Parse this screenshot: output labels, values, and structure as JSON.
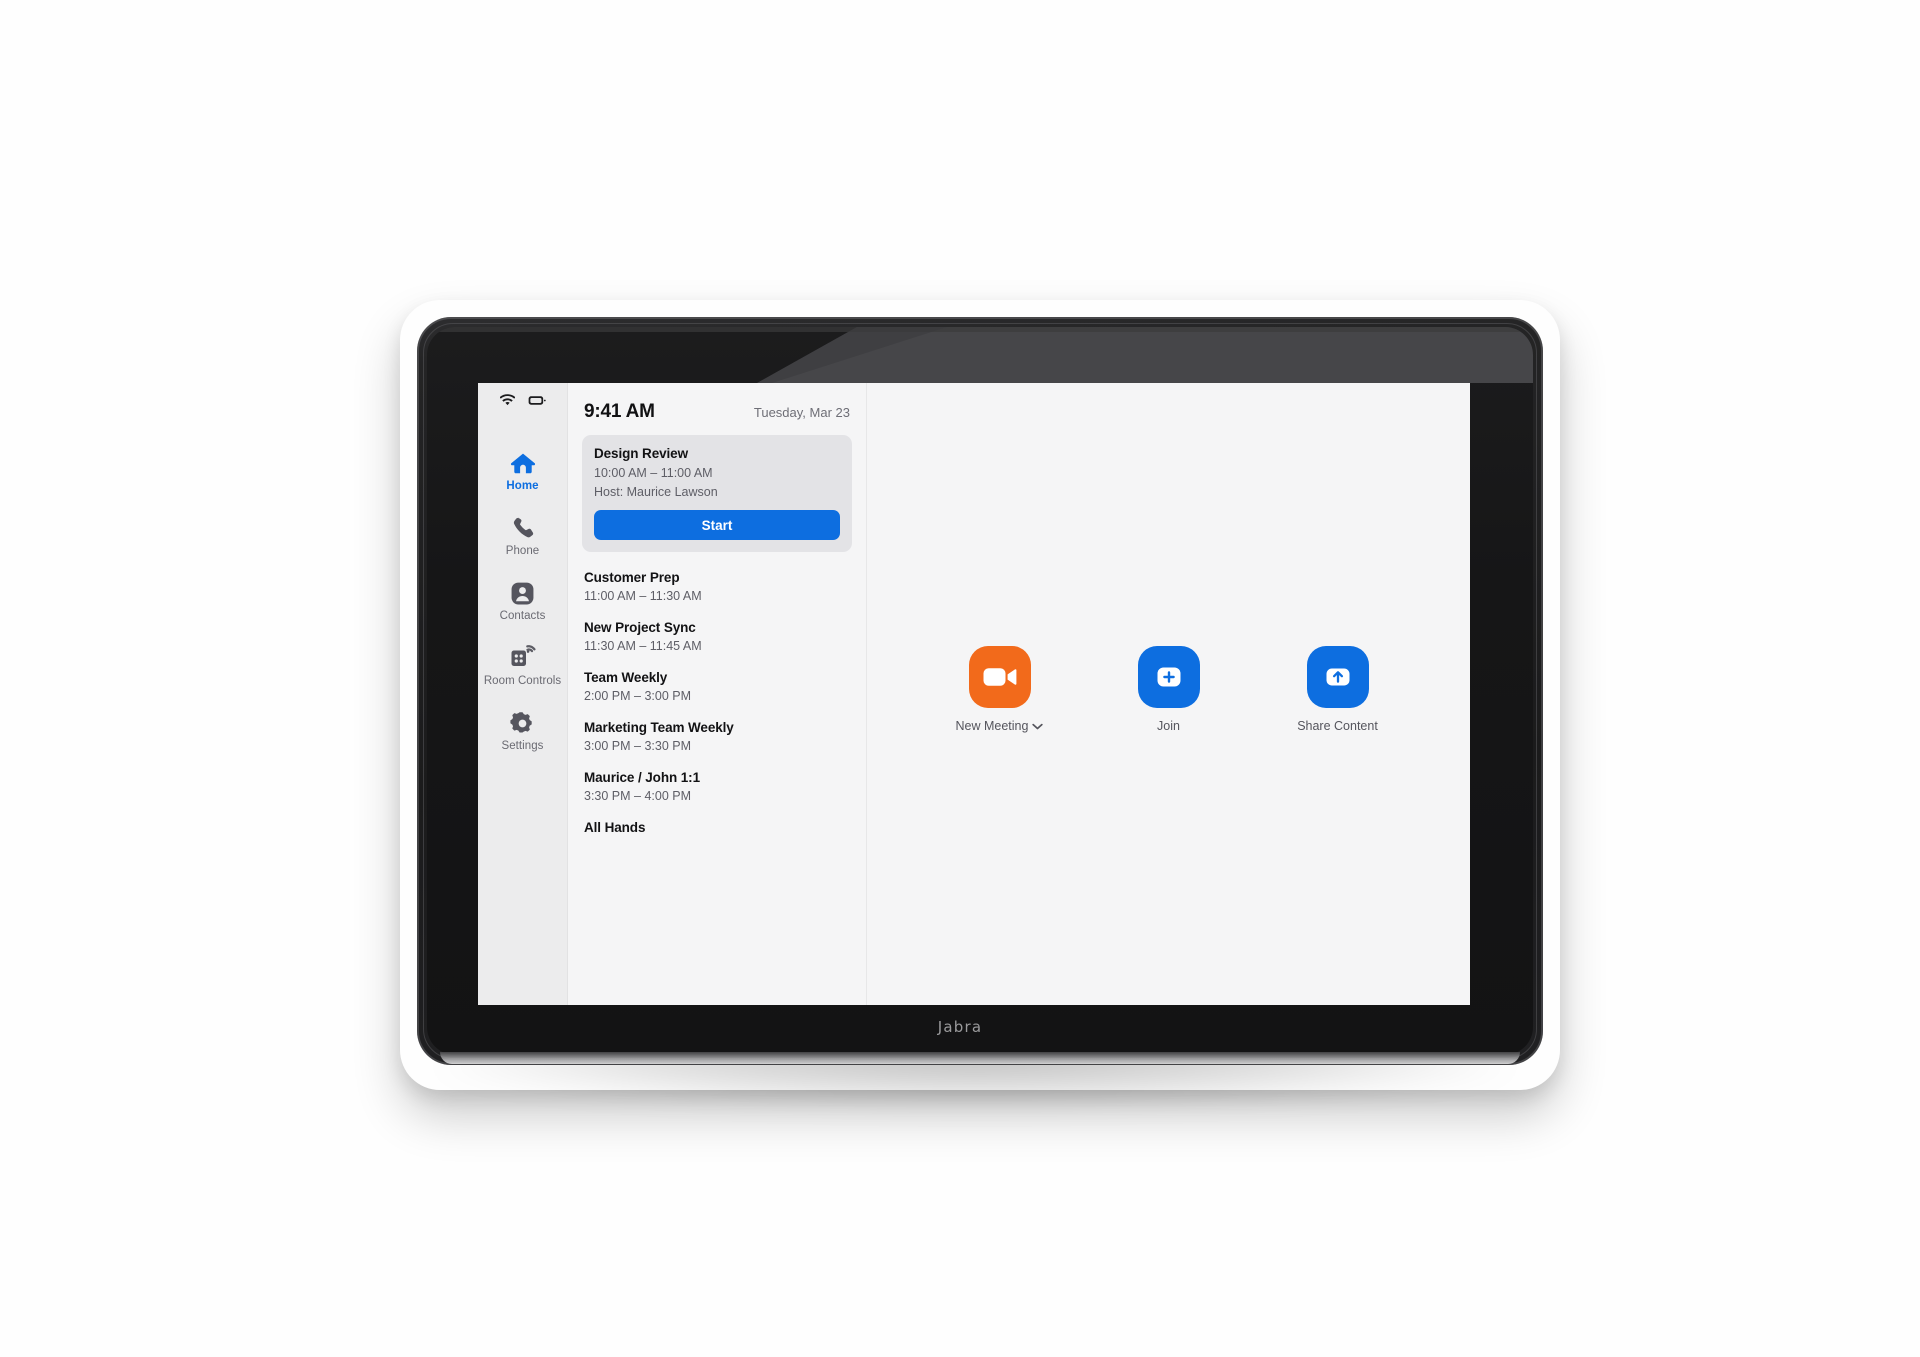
{
  "device": {
    "brand": "Jabra",
    "type": "touch-controller"
  },
  "statusbar": {
    "wifi_icon": "wifi-icon",
    "battery_icon": "battery-icon"
  },
  "sidebar": {
    "items": [
      {
        "label": "Home",
        "icon": "home-icon",
        "active": true
      },
      {
        "label": "Phone",
        "icon": "phone-icon",
        "active": false
      },
      {
        "label": "Contacts",
        "icon": "contacts-icon",
        "active": false
      },
      {
        "label": "Room Controls",
        "icon": "room-controls-icon",
        "active": false
      },
      {
        "label": "Settings",
        "icon": "gear-icon",
        "active": false
      }
    ]
  },
  "header": {
    "time": "9:41 AM",
    "date": "Tuesday, Mar 23"
  },
  "current_meeting": {
    "title": "Design Review",
    "time": "10:00 AM – 11:00 AM",
    "host": "Host: Maurice Lawson",
    "start_label": "Start"
  },
  "upcoming_meetings": [
    {
      "title": "Customer Prep",
      "time": "11:00 AM – 11:30 AM"
    },
    {
      "title": "New Project Sync",
      "time": "11:30 AM – 11:45 AM"
    },
    {
      "title": "Team Weekly",
      "time": "2:00 PM – 3:00 PM"
    },
    {
      "title": "Marketing Team Weekly",
      "time": "3:00 PM – 3:30 PM"
    },
    {
      "title": "Maurice / John 1:1",
      "time": "3:30 PM – 4:00 PM"
    },
    {
      "title": "All Hands",
      "time": ""
    }
  ],
  "actions": [
    {
      "label": "New Meeting",
      "icon": "video-camera-icon",
      "color": "#f26a1b",
      "has_chevron": true
    },
    {
      "label": "Join",
      "icon": "plus-in-screen-icon",
      "color": "#0d6ee0",
      "has_chevron": false
    },
    {
      "label": "Share Content",
      "icon": "share-up-arrow-icon",
      "color": "#0d6ee0",
      "has_chevron": false
    }
  ],
  "colors": {
    "accent_blue": "#0d6ee0",
    "accent_orange": "#f26a1b",
    "screen_bg": "#f5f5f6",
    "sidebar_bg": "#ececed",
    "card_bg": "#e3e3e6"
  }
}
